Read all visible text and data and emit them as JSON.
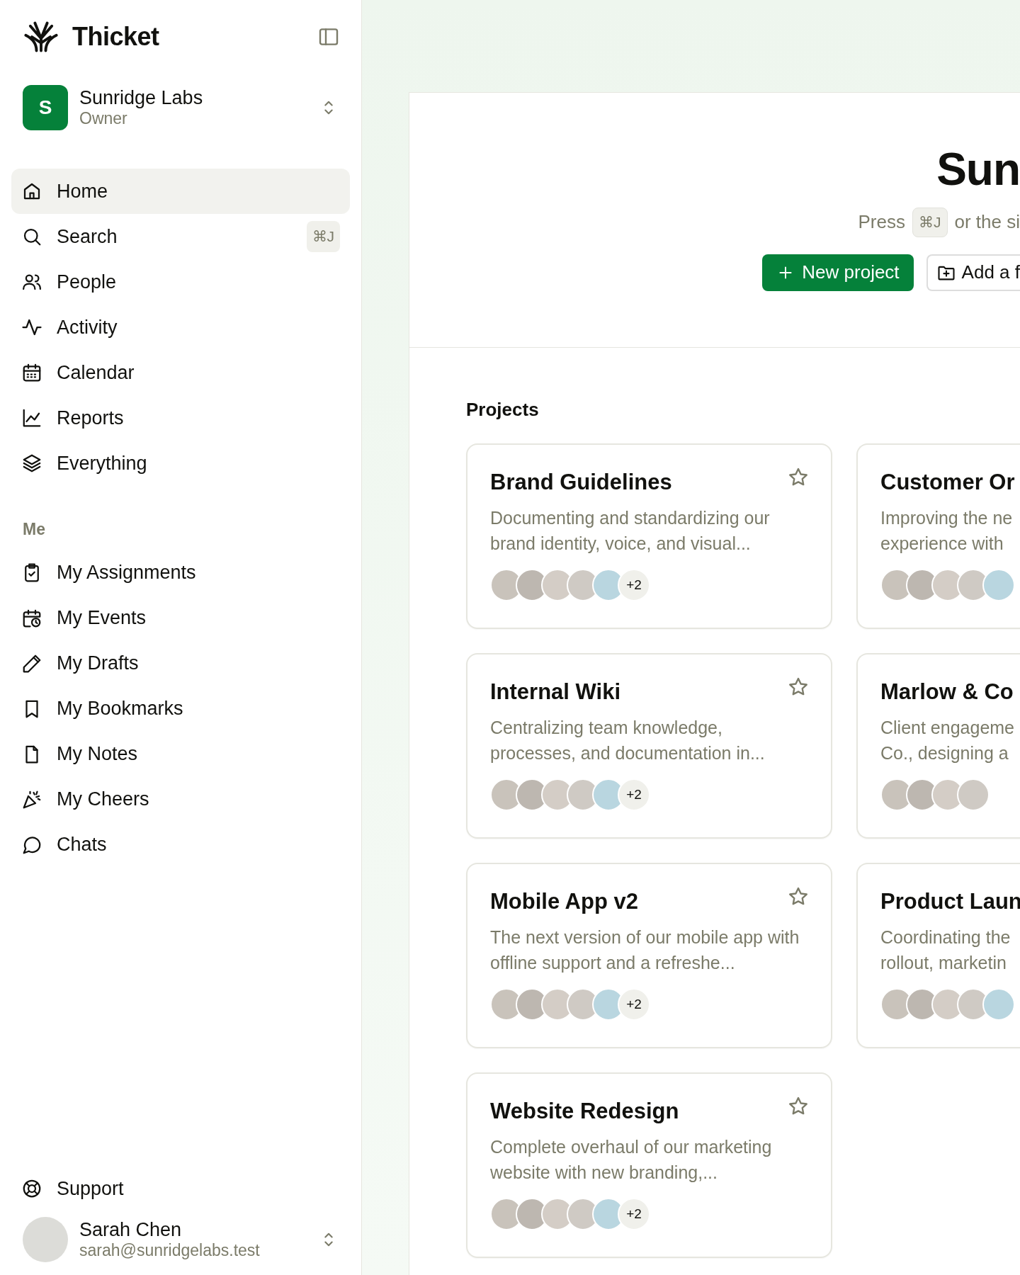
{
  "brand": {
    "name": "Thicket"
  },
  "workspace": {
    "initial": "S",
    "name": "Sunridge Labs",
    "role": "Owner"
  },
  "nav": [
    {
      "label": "Home",
      "selected": true
    },
    {
      "label": "Search",
      "selected": false,
      "shortcut": "⌘J"
    },
    {
      "label": "People",
      "selected": false
    },
    {
      "label": "Activity",
      "selected": false
    },
    {
      "label": "Calendar",
      "selected": false
    },
    {
      "label": "Reports",
      "selected": false
    },
    {
      "label": "Everything",
      "selected": false
    }
  ],
  "me_section": {
    "heading": "Me",
    "items": [
      {
        "label": "My Assignments",
        "selected": false
      },
      {
        "label": "My Events",
        "selected": false
      },
      {
        "label": "My Drafts",
        "selected": false
      },
      {
        "label": "My Bookmarks",
        "selected": false
      },
      {
        "label": "My Notes",
        "selected": false
      },
      {
        "label": "My Cheers",
        "selected": false
      },
      {
        "label": "Chats",
        "selected": false
      }
    ]
  },
  "support": {
    "label": "Support"
  },
  "user": {
    "name": "Sarah Chen",
    "email": "sarah@sunridgelabs.test"
  },
  "hero": {
    "title": "Sun",
    "hint_before": "Press",
    "hint_key": "⌘J",
    "hint_after": "or the si",
    "buttons": [
      {
        "label": "New project",
        "kind": "primary"
      },
      {
        "label": "Add a f",
        "kind": "secondary"
      }
    ]
  },
  "projects": {
    "heading": "Projects",
    "cards": [
      {
        "title": "Brand Guidelines",
        "description": "Documenting and standardizing our brand identity, voice, and visual...",
        "starred": false,
        "avatars": [
          {
            "kind": "photo"
          },
          {
            "kind": "photo"
          },
          {
            "kind": "photo"
          },
          {
            "kind": "photo"
          },
          {
            "kind": "photo"
          }
        ],
        "extra": "+2"
      },
      {
        "title": "Customer Or",
        "description": "Improving the ne\nexperience with",
        "avatars": [
          {
            "kind": "photo"
          },
          {
            "kind": "photo"
          },
          {
            "kind": "photo"
          },
          {
            "kind": "photo"
          },
          {
            "kind": "photo"
          }
        ]
      },
      {
        "title": "Internal Wiki",
        "description": "Centralizing team knowledge, processes, and documentation in...",
        "starred": false,
        "avatars": [
          {
            "kind": "photo"
          },
          {
            "kind": "photo"
          },
          {
            "kind": "photo"
          },
          {
            "kind": "photo"
          },
          {
            "kind": "photo"
          }
        ],
        "extra": "+2"
      },
      {
        "title": "Marlow & Co",
        "description": "Client engageme\nCo., designing a",
        "avatars": [
          {
            "kind": "photo"
          },
          {
            "kind": "photo"
          },
          {
            "kind": "photo"
          },
          {
            "kind": "photo"
          }
        ]
      },
      {
        "title": "Mobile App v2",
        "description": "The next version of our mobile app with offline support and a refreshe...",
        "starred": false,
        "avatars": [
          {
            "kind": "photo"
          },
          {
            "kind": "photo"
          },
          {
            "kind": "photo"
          },
          {
            "kind": "photo"
          },
          {
            "kind": "photo"
          }
        ],
        "extra": "+2"
      },
      {
        "title": "Product Laun",
        "description": "Coordinating the\nrollout, marketin",
        "avatars": [
          {
            "kind": "photo"
          },
          {
            "kind": "photo"
          },
          {
            "kind": "photo"
          },
          {
            "kind": "photo"
          },
          {
            "kind": "photo"
          }
        ]
      },
      {
        "title": "Website Redesign",
        "description": "Complete overhaul of our marketing website with new branding,...",
        "starred": false,
        "avatars": [
          {
            "kind": "photo"
          },
          {
            "kind": "photo"
          },
          {
            "kind": "photo"
          },
          {
            "kind": "photo"
          },
          {
            "kind": "photo"
          }
        ],
        "extra": "+2"
      }
    ]
  }
}
